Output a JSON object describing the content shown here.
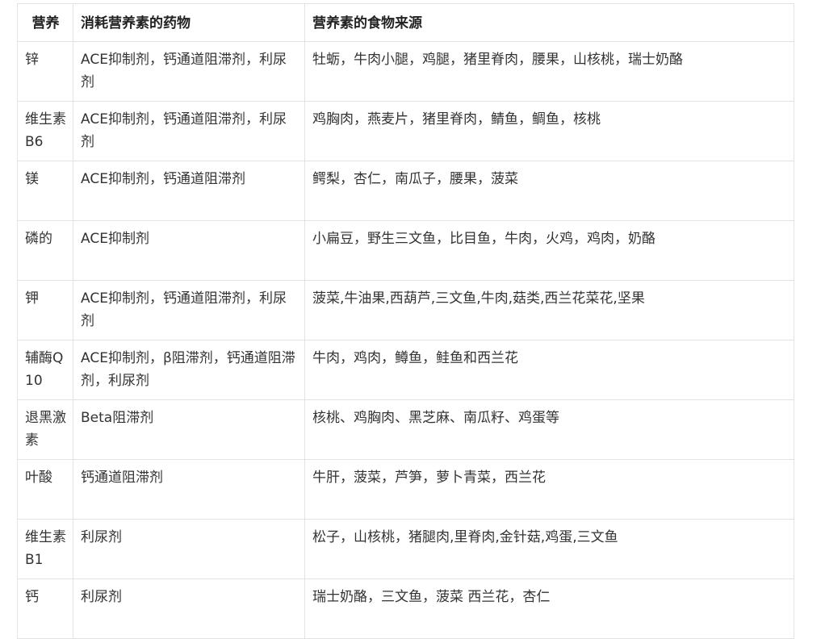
{
  "table": {
    "headers": [
      "营养",
      "消耗营养素的药物",
      "营养素的食物来源"
    ],
    "rows": [
      [
        "锌",
        "ACE抑制剂，钙通道阻滞剂，利尿剂",
        "牡蛎，牛肉小腿，鸡腿，猪里脊肉，腰果，山核桃，瑞士奶酪"
      ],
      [
        "维生素B6",
        "ACE抑制剂，钙通道阻滞剂，利尿剂",
        "鸡胸肉，燕麦片，猪里脊肉，鲭鱼，鲷鱼，核桃"
      ],
      [
        "镁",
        "ACE抑制剂，钙通道阻滞剂",
        "鳄梨，杏仁，南瓜子，腰果，菠菜"
      ],
      [
        "磷的",
        "ACE抑制剂",
        "小扁豆，野生三文鱼，比目鱼，牛肉，火鸡，鸡肉，奶酪"
      ],
      [
        "钾",
        "ACE抑制剂，钙通道阻滞剂，利尿剂",
        "菠菜,牛油果,西葫芦,三文鱼,牛肉,菇类,西兰花菜花,坚果"
      ],
      [
        "辅酶Q10",
        "ACE抑制剂，β阻滞剂，钙通道阻滞剂，利尿剂",
        "牛肉，鸡肉，鳟鱼，鲑鱼和西兰花"
      ],
      [
        "退黑激素",
        "Beta阻滞剂",
        "核桃、鸡胸肉、黑芝麻、南瓜籽、鸡蛋等"
      ],
      [
        "叶酸",
        "钙通道阻滞剂",
        "牛肝，菠菜，芦笋，萝卜青菜，西兰花"
      ],
      [
        "维生素B1",
        "利尿剂",
        "松子，山核桃，猪腿肉,里脊肉,金针菇,鸡蛋,三文鱼"
      ],
      [
        "钙",
        "利尿剂",
        "瑞士奶酪，三文鱼，菠菜 西兰花，杏仁"
      ]
    ]
  }
}
